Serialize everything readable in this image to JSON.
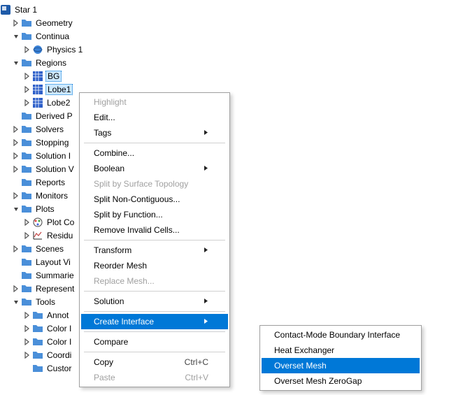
{
  "root": {
    "label": "Star 1"
  },
  "tree": {
    "geometry": "Geometry",
    "continua": "Continua",
    "physics": "Physics 1",
    "regions": "Regions",
    "bg": "BG",
    "lobe1": "Lobe1",
    "lobe2": "Lobe2",
    "derivedParts": "Derived P",
    "solvers": "Solvers",
    "stopping": "Stopping",
    "solution1": "Solution I",
    "solution2": "Solution V",
    "reports": "Reports",
    "monitors": "Monitors",
    "plots": "Plots",
    "plotCo": "Plot Co",
    "residu": "Residu",
    "scenes": "Scenes",
    "layoutVi": "Layout Vi",
    "summari": "Summarie",
    "represent": "Represent",
    "tools": "Tools",
    "annot": "Annot",
    "color1": "Color I",
    "color2": "Color I",
    "coordi": "Coordi",
    "custom": "Custor"
  },
  "menu": {
    "highlight": "Highlight",
    "edit": "Edit...",
    "tags": "Tags",
    "combine": "Combine...",
    "boolean": "Boolean",
    "splitSurface": "Split by Surface Topology",
    "splitNonContig": "Split Non-Contiguous...",
    "splitFunction": "Split by Function...",
    "removeInvalid": "Remove Invalid Cells...",
    "transform": "Transform",
    "reorderMesh": "Reorder Mesh",
    "replaceMesh": "Replace Mesh...",
    "solution": "Solution",
    "createInterface": "Create Interface",
    "compare": "Compare",
    "copy": "Copy",
    "copyShortcut": "Ctrl+C",
    "paste": "Paste",
    "pasteShortcut": "Ctrl+V"
  },
  "submenu": {
    "contactMode": "Contact-Mode Boundary Interface",
    "heatExchanger": "Heat Exchanger",
    "oversetMesh": "Overset Mesh",
    "oversetGap": "Overset Mesh ZeroGap"
  }
}
